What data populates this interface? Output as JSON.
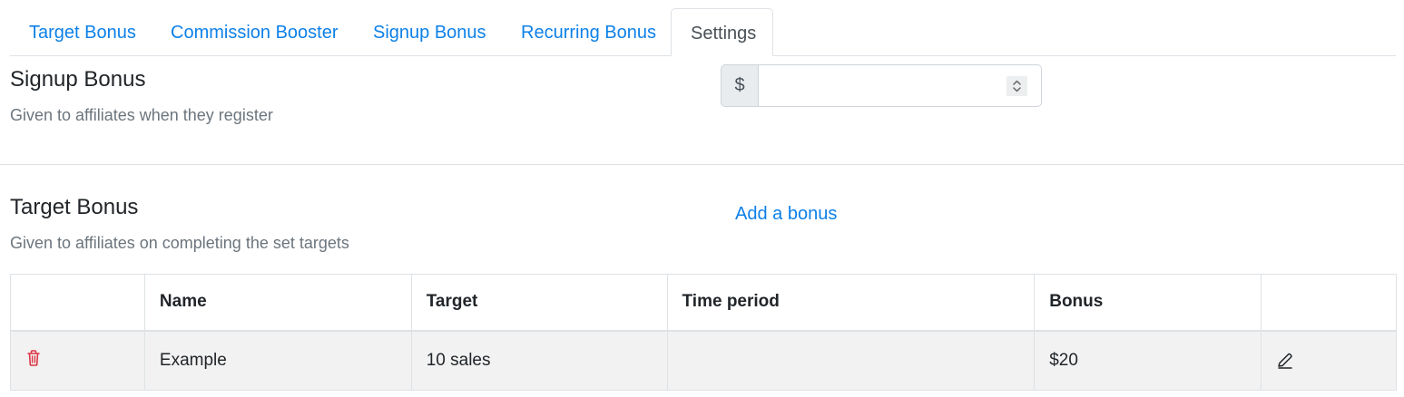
{
  "tabs": [
    {
      "label": "Target Bonus",
      "active": false
    },
    {
      "label": "Commission Booster",
      "active": false
    },
    {
      "label": "Signup Bonus",
      "active": false
    },
    {
      "label": "Recurring Bonus",
      "active": false
    },
    {
      "label": "Settings",
      "active": true
    }
  ],
  "signup_bonus": {
    "title": "Signup Bonus",
    "description": "Given to affiliates when they register",
    "currency_symbol": "$",
    "amount_value": "",
    "amount_placeholder": ""
  },
  "target_bonus": {
    "title": "Target Bonus",
    "description": "Given to affiliates on completing the set targets",
    "add_link": "Add a bonus",
    "table": {
      "headers": [
        "",
        "Name",
        "Target",
        "Time period",
        "Bonus",
        ""
      ],
      "rows": [
        {
          "name": "Example",
          "target": "10 sales",
          "time_period": "",
          "bonus": "$20"
        }
      ]
    }
  },
  "colors": {
    "link": "#0d80e8",
    "muted": "#6c757d",
    "danger": "#dc3545",
    "border": "#dee2e6",
    "row_bg": "#f2f2f2"
  },
  "icons": {
    "delete": "trash-icon",
    "edit": "pencil-icon",
    "spinner": "stepper-arrows-icon"
  }
}
